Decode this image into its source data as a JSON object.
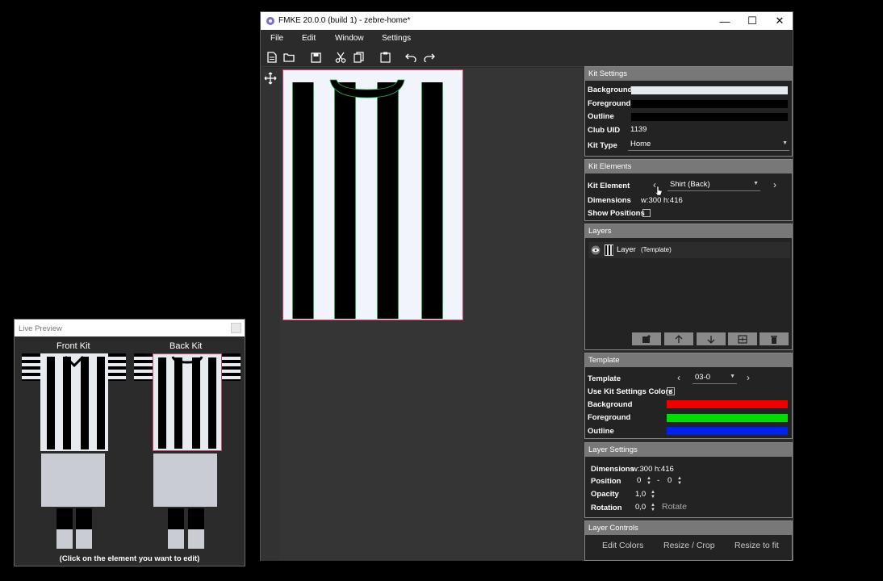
{
  "main_window": {
    "title": "FMKE 20.0.0 (build 1) - zebre-home*",
    "controls": {
      "minimize": "—",
      "maximize": "☐",
      "close": "✕"
    }
  },
  "menu": [
    "File",
    "Edit",
    "Window",
    "Settings"
  ],
  "toolbar_icons": [
    "new-file-icon",
    "open-folder-icon",
    "save-icon",
    "cut-icon",
    "copy-icon",
    "paste-icon",
    "undo-icon",
    "redo-icon"
  ],
  "kit_settings": {
    "header": "Kit Settings",
    "background_label": "Background",
    "foreground_label": "Foreground",
    "outline_label": "Outline",
    "colors": {
      "background": "#e8ebee",
      "foreground": "#000000",
      "outline": "#000000"
    },
    "club_uid_label": "Club UID",
    "club_uid": "1139",
    "kit_type_label": "Kit Type",
    "kit_type": "Home"
  },
  "kit_elements": {
    "header": "Kit Elements",
    "kit_element_label": "Kit Element",
    "kit_element": "Shirt (Back)",
    "dimensions_label": "Dimensions",
    "dimensions": "w:300 h:416",
    "show_positions_label": "Show Positions",
    "show_positions": false
  },
  "layers": {
    "header": "Layers",
    "items": [
      {
        "name": "Layer",
        "type": "(Template)"
      }
    ]
  },
  "template": {
    "header": "Template",
    "template_label": "Template",
    "template_value": "03-0",
    "use_colors_label": "Use Kit Settings Colors",
    "use_colors": true,
    "background_label": "Background",
    "foreground_label": "Foreground",
    "outline_label": "Outline",
    "colors": {
      "background": "#ee0000",
      "foreground": "#00dd00",
      "outline": "#0022ee"
    }
  },
  "layer_settings": {
    "header": "Layer Settings",
    "dimensions_label": "Dimensions",
    "dimensions": "w:300 h:416",
    "position_label": "Position",
    "position_x": "0",
    "position_sep": "-",
    "position_y": "0",
    "opacity_label": "Opacity",
    "opacity": "1,0",
    "rotation_label": "Rotation",
    "rotation": "0,0",
    "rotate_button": "Rotate"
  },
  "layer_controls": {
    "header": "Layer Controls",
    "edit_colors": "Edit Colors",
    "resize_crop": "Resize / Crop",
    "resize_fit": "Resize to fit"
  },
  "preview": {
    "title": "Live Preview",
    "front_label": "Front Kit",
    "back_label": "Back Kit",
    "footer": "(Click on the element you want to edit)"
  }
}
